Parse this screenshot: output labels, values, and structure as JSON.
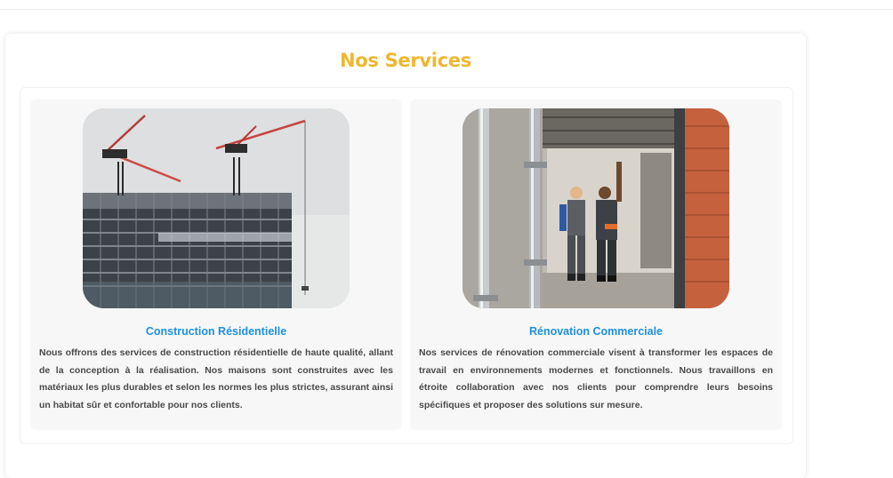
{
  "section": {
    "title": "Nos Services"
  },
  "services": [
    {
      "title": "Construction Résidentielle",
      "description": "Nous offrons des services de construction résidentielle de haute qualité, allant de la conception à la réalisation. Nos maisons sont construites avec les matériaux les plus durables et selon les normes les plus strictes, assurant ainsi un habitat sûr et confortable pour nos clients.",
      "image": "building-with-cranes"
    },
    {
      "title": "Rénovation Commerciale",
      "description": "Nos services de rénovation commerciale visent à transformer les espaces de travail en environnements modernes et fonctionnels. Nous travaillons en étroite collaboration avec nos clients pour comprendre leurs besoins spécifiques et proposer des solutions sur mesure.",
      "image": "workers-renovation-interior"
    }
  ],
  "colors": {
    "title": "#efb72f",
    "card_title": "#1e90e0",
    "text": "#4a4a4a",
    "card_bg": "#f7f7f7"
  }
}
